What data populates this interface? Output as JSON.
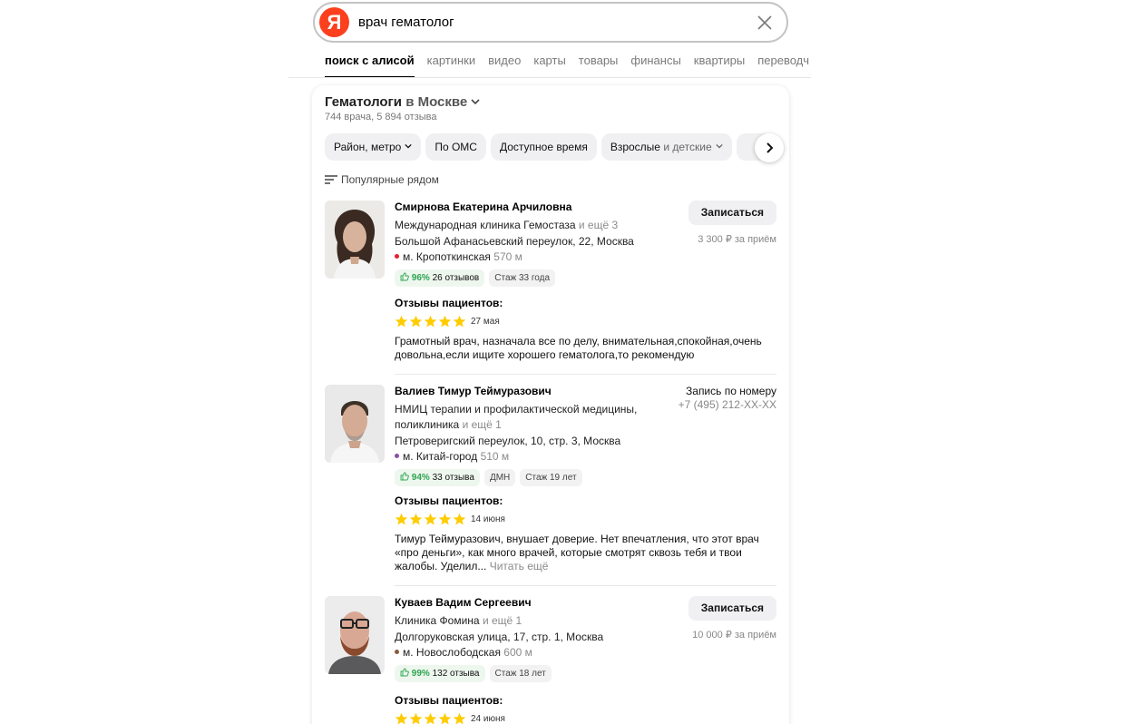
{
  "search": {
    "logo_letter": "Я",
    "query": "врач гематолог"
  },
  "tabs": [
    {
      "label": "поиск с алисой",
      "active": true
    },
    {
      "label": "картинки"
    },
    {
      "label": "видео"
    },
    {
      "label": "карты"
    },
    {
      "label": "товары"
    },
    {
      "label": "финансы"
    },
    {
      "label": "квартиры"
    },
    {
      "label": "переводч"
    }
  ],
  "card": {
    "title": "Гематологи",
    "title_in": "в Москве",
    "subtitle": "744 врача, 5 894 отзыва",
    "filters": {
      "district": "Район, метро",
      "oms": "По ОМС",
      "time": "Доступное время",
      "age_main": "Взрослые",
      "age_rest": "и детские"
    },
    "sort_label": "Популярные рядом"
  },
  "doctors": [
    {
      "name": "Смирнова Екатерина Арчиловна",
      "clinic": "Международная клиника Гемостаза",
      "clinic_more": "и ещё 3",
      "address": "Большой Афанасьевский переулок, 22, Москва",
      "metro": "м. Кропоткинская",
      "metro_distance": "570 м",
      "metro_color": "#e4202b",
      "rating": "96%",
      "reviews_count": "26 отзывов",
      "experience": "Стаж 33 года",
      "action_label": "Записаться",
      "price": "3 300 ₽ за приём",
      "reviews_heading": "Отзывы пациентов:",
      "review_date": "27 мая",
      "review_stars": 5,
      "review_text": "Грамотный врач, назначала все по делу, внимательная,спокойная,очень довольна,если ищите хорошего гематолога,то рекомендую"
    },
    {
      "name": "Валиев Тимур Теймуразович",
      "clinic_line1": "НМИЦ терапии и профилактической медицины,",
      "clinic_line2": "поликлиника",
      "clinic_more": "и ещё 1",
      "address": "Петроверигский переулок, 10, стр. 3, Москва",
      "metro": "м. Китай-город",
      "metro_distance": "510 м",
      "metro_color": "#8b4ea6",
      "rating": "94%",
      "reviews_count": "33 отзыва",
      "degree": "ДМН",
      "experience": "Стаж 19 лет",
      "phone_label": "Запись по номеру",
      "phone": "+7 (495) 212-ХХ-ХХ",
      "reviews_heading": "Отзывы пациентов:",
      "review_date": "14 июня",
      "review_stars": 5,
      "review_text": "Тимур Теймуразович, внушает доверие. Нет впечатления, что этот врач «про деньги», как много врачей, которые смотрят сквозь тебя и твои жалобы. Уделил...",
      "read_more": "Читать ещё"
    },
    {
      "name": "Куваев Вадим Сергеевич",
      "clinic": "Клиника Фомина",
      "clinic_more": "и ещё 1",
      "address": "Долгоруковская улица, 17, стр. 1, Москва",
      "metro": "м. Новослободская",
      "metro_distance": "600 м",
      "metro_color": "#8a5a3b",
      "rating": "99%",
      "reviews_count": "132 отзыва",
      "experience": "Стаж 18 лет",
      "action_label": "Записаться",
      "price": "10 000 ₽ за приём",
      "reviews_heading": "Отзывы пациентов:",
      "review_date": "24 июня",
      "review_stars": 5
    }
  ],
  "colors": {
    "brand": "#fc3f1d",
    "star": "#ffcc00",
    "rating_green": "#2ea44f"
  }
}
